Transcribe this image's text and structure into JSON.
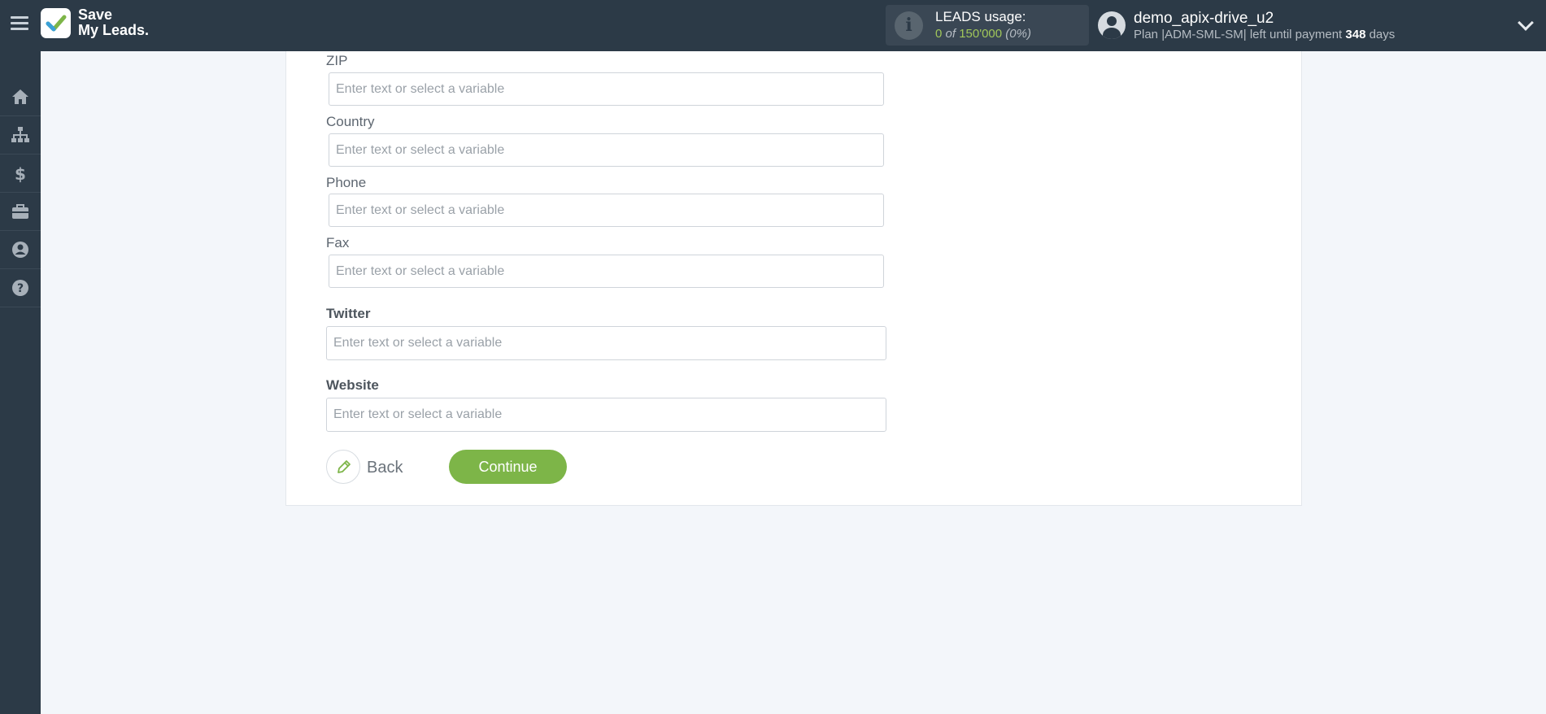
{
  "header": {
    "brand_line1": "Save",
    "brand_line2": "My Leads.",
    "leads_label": "LEADS usage:",
    "leads_used": "0",
    "leads_of": "of",
    "leads_total": "150'000",
    "leads_pct": "(0%)",
    "username": "demo_apix-drive_u2",
    "plan_prefix": "Plan |ADM-SML-SM| left until payment",
    "plan_days": "348",
    "plan_suffix": "days"
  },
  "sidebar": {
    "items": [
      {
        "icon": "home-icon"
      },
      {
        "icon": "sitemap-icon"
      },
      {
        "icon": "dollar-icon"
      },
      {
        "icon": "briefcase-icon"
      },
      {
        "icon": "user-icon"
      },
      {
        "icon": "help-icon"
      }
    ]
  },
  "form": {
    "fields": [
      {
        "label": "ZIP",
        "placeholder": "Enter text or select a variable",
        "value": ""
      },
      {
        "label": "Country",
        "placeholder": "Enter text or select a variable",
        "value": ""
      },
      {
        "label": "Phone",
        "placeholder": "Enter text or select a variable",
        "value": ""
      },
      {
        "label": "Fax",
        "placeholder": "Enter text or select a variable",
        "value": ""
      },
      {
        "label": "Twitter",
        "placeholder": "Enter text or select a variable",
        "value": ""
      },
      {
        "label": "Website",
        "placeholder": "Enter text or select a variable",
        "value": ""
      }
    ],
    "back_label": "Back",
    "continue_label": "Continue"
  },
  "colors": {
    "topbar": "#2c3a47",
    "accent_green": "#7db548",
    "background": "#f3f6fa"
  }
}
